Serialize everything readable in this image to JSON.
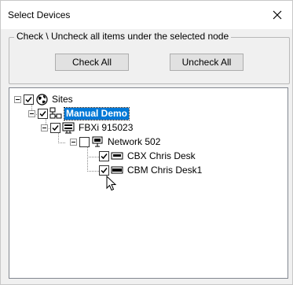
{
  "window": {
    "title": "Select Devices"
  },
  "group": {
    "legend": "Check \\ Uncheck all items under the selected node",
    "check_all_label": "Check All",
    "uncheck_all_label": "Uncheck All"
  },
  "tree": {
    "nodes": [
      {
        "label": "Sites",
        "checked": true,
        "icon": "globe-icon"
      },
      {
        "label": "Manual Demo",
        "checked": true,
        "icon": "network-icon",
        "selected": true
      },
      {
        "label": "FBXi 915023",
        "checked": true,
        "icon": "server-icon"
      },
      {
        "label": "Network 502",
        "checked": false,
        "icon": "monitor-icon"
      },
      {
        "label": "CBX Chris Desk",
        "checked": true,
        "icon": "device-icon"
      },
      {
        "label": "CBM Chris Desk1",
        "checked": true,
        "icon": "device-icon"
      }
    ]
  }
}
